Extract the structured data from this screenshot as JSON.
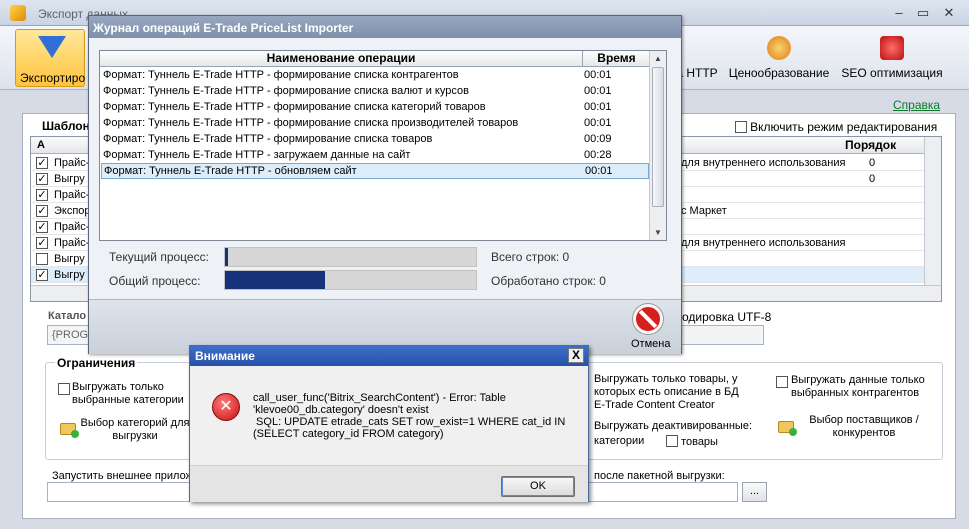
{
  "main_window": {
    "title": "Экспорт данных",
    "ribbon": {
      "active_label": "Экспортиро",
      "item_http": "а HTTP",
      "item_pricing": "Ценообразование",
      "item_seo": "SEO оптимизация"
    },
    "help_link": "Справка",
    "templates_label": "Шаблон",
    "edit_mode_label": "Включить режим редактирования",
    "grid": {
      "col_a": "А",
      "col_order": "Порядок",
      "rows": [
        {
          "name": "Прайс-",
          "checked": true,
          "right": "для внутреннего использования",
          "order": "0"
        },
        {
          "name": "Выгру",
          "checked": true,
          "right": "",
          "order": "0"
        },
        {
          "name": "Прайс-",
          "checked": true,
          "right": "",
          "order": ""
        },
        {
          "name": "Экспор",
          "checked": true,
          "right": "с Маркет",
          "order": ""
        },
        {
          "name": "Прайс-",
          "checked": true,
          "right": "",
          "order": ""
        },
        {
          "name": "Прайс-",
          "checked": true,
          "right": "для внутреннего использования",
          "order": ""
        },
        {
          "name": "Выгру",
          "checked": false,
          "right": "",
          "order": ""
        },
        {
          "name": "Выгру",
          "checked": true,
          "right": "",
          "order": ""
        }
      ]
    },
    "catalog_label": "Катало",
    "catalog_value": "{PROGR",
    "encoding_label": "одировка UTF-8",
    "restrictions_title": "Ограничения",
    "opt_selected_categories": "Выгружать только выбранные категории",
    "btn_select_categories": "Выбор категорий для выгрузки",
    "opt_only_with_desc": "Выгружать только товары, у которых есть описание в БД E-Trade Content Creator",
    "opt_selected_contractors": "Выгружать данные только выбранных контрагентов",
    "opt_deactivated": "Выгружать деактивированные:",
    "opt_cat": "категории",
    "opt_goods": "товары",
    "btn_select_suppliers": "Выбор поставщиков / конкурентов",
    "run_external_label": "Запустить внешнее прилож",
    "after_batch_label": "после пакетной выгрузки:",
    "browse_button": "..."
  },
  "journal": {
    "title": "Журнал операций E-Trade PriceList Importer",
    "col_operation": "Наименование операции",
    "col_time": "Время",
    "rows": [
      {
        "op": "Формат: Туннель E-Trade HTTP - формирование списка контрагентов",
        "time": "00:01"
      },
      {
        "op": "Формат: Туннель E-Trade HTTP - формирование списка валют и курсов",
        "time": "00:01"
      },
      {
        "op": "Формат: Туннель E-Trade HTTP - формирование списка категорий товаров",
        "time": "00:01"
      },
      {
        "op": "Формат: Туннель E-Trade HTTP - формирование списка производителей товаров",
        "time": "00:01"
      },
      {
        "op": "Формат: Туннель E-Trade HTTP - формирование списка товаров",
        "time": "00:09"
      },
      {
        "op": "Формат: Туннель E-Trade HTTP - загружаем данные на сайт",
        "time": "00:28"
      },
      {
        "op": "Формат: Туннель E-Trade HTTP - обновляем сайт",
        "time": "00:01"
      }
    ],
    "current_process_label": "Текущий процесс:",
    "total_process_label": "Общий процесс:",
    "current_progress": 0.01,
    "total_progress": 0.4,
    "total_rows": "Всего строк: 0",
    "processed_rows": "Обработано строк: 0",
    "cancel_label": "Отмена"
  },
  "warning": {
    "title": "Внимание",
    "close": "X",
    "message_lines": [
      "call_user_func('Bitrix_SearchContent') - Error: Table",
      "'klevoe00_db.category' doesn't exist",
      " SQL: UPDATE etrade_cats SET row_exist=1 WHERE cat_id IN",
      "(SELECT category_id FROM category)"
    ],
    "ok_label": "OK"
  },
  "colors": {
    "progress_fill": "#16327a",
    "warning_title": "#2651a8",
    "journal_title": "#8596b2",
    "error_icon": "#c81010"
  },
  "icons": [
    "app-icon",
    "export-icon",
    "pricing-icon",
    "seo-icon",
    "cancel-icon",
    "error-icon",
    "folder-add-icon"
  ]
}
